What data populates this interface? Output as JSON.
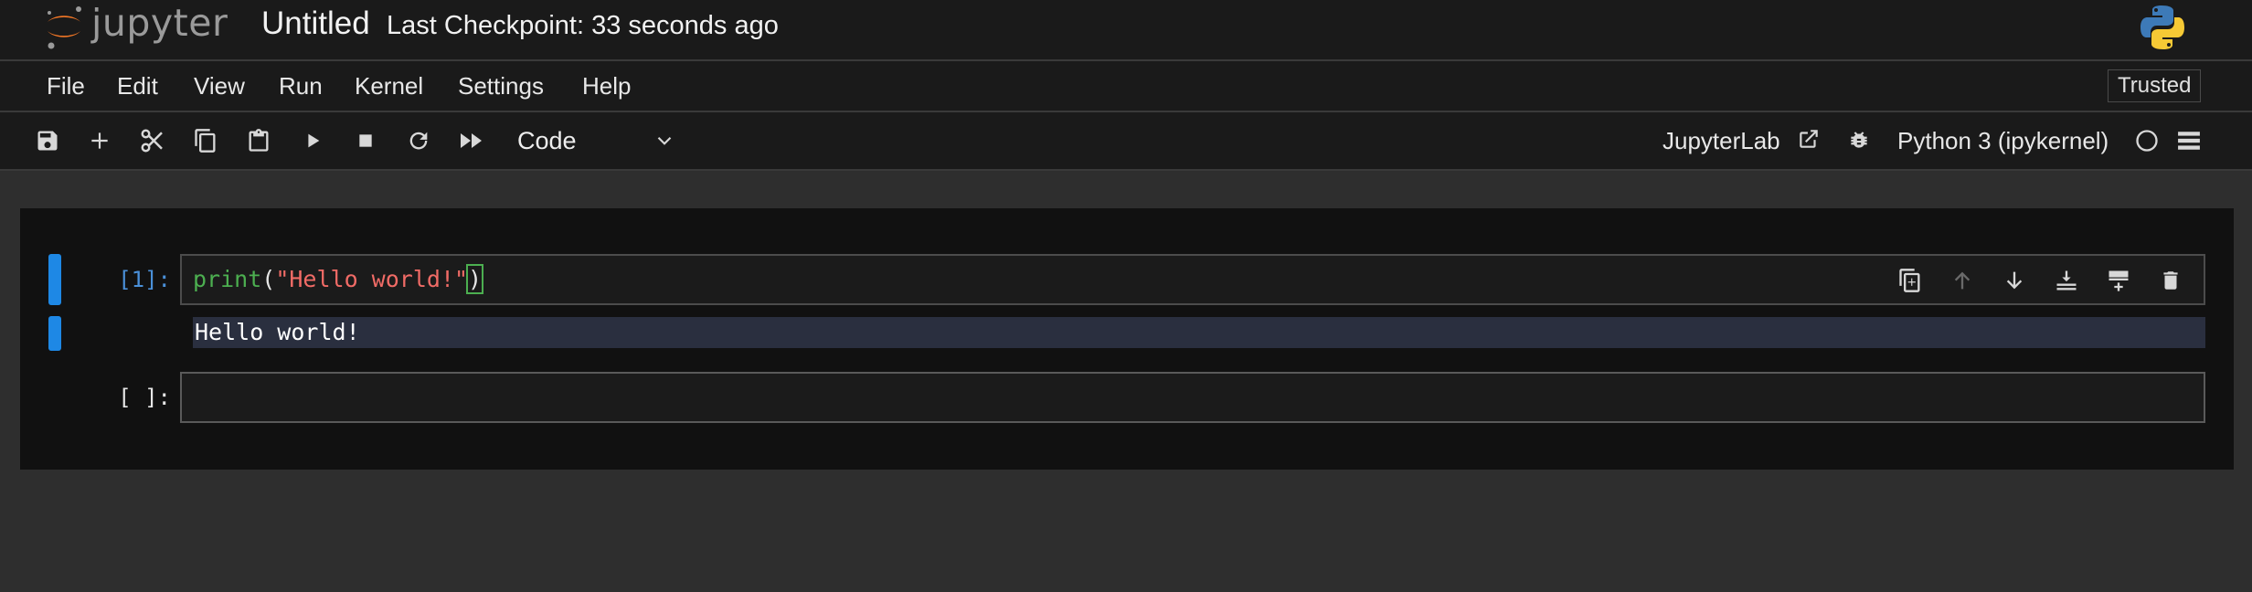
{
  "header": {
    "logo_text": "jupyter",
    "title": "Untitled",
    "checkpoint": "Last Checkpoint: 33 seconds ago"
  },
  "menu": {
    "items": [
      "File",
      "Edit",
      "View",
      "Run",
      "Kernel",
      "Settings",
      "Help"
    ],
    "trusted": "Trusted"
  },
  "toolbar": {
    "cell_type": "Code",
    "jupyterlab": "JupyterLab",
    "kernel": "Python 3 (ipykernel)"
  },
  "cells": [
    {
      "prompt": "[1]:",
      "code": {
        "fn": "print",
        "open": "(",
        "str": "\"Hello world!\"",
        "close": ")"
      },
      "output": "Hello world!"
    },
    {
      "prompt": "[ ]:",
      "code": ""
    }
  ],
  "colors": {
    "accent_blue": "#1e88e5",
    "logo_orange": "#f37726",
    "code_function": "#4caf50",
    "code_string": "#f06b66",
    "output_bg": "#2a2f3f"
  },
  "icons": {
    "toolbar": [
      "save-icon",
      "add-cell-icon",
      "cut-icon",
      "copy-icon",
      "paste-icon",
      "run-icon",
      "stop-icon",
      "restart-icon",
      "run-all-icon"
    ],
    "cell_toolbar": [
      "duplicate-icon",
      "move-up-icon",
      "move-down-icon",
      "insert-below-icon",
      "insert-above-icon",
      "delete-icon"
    ],
    "kernel": [
      "external-link-icon",
      "bug-icon",
      "kernel-status-icon",
      "menu-icon"
    ]
  }
}
